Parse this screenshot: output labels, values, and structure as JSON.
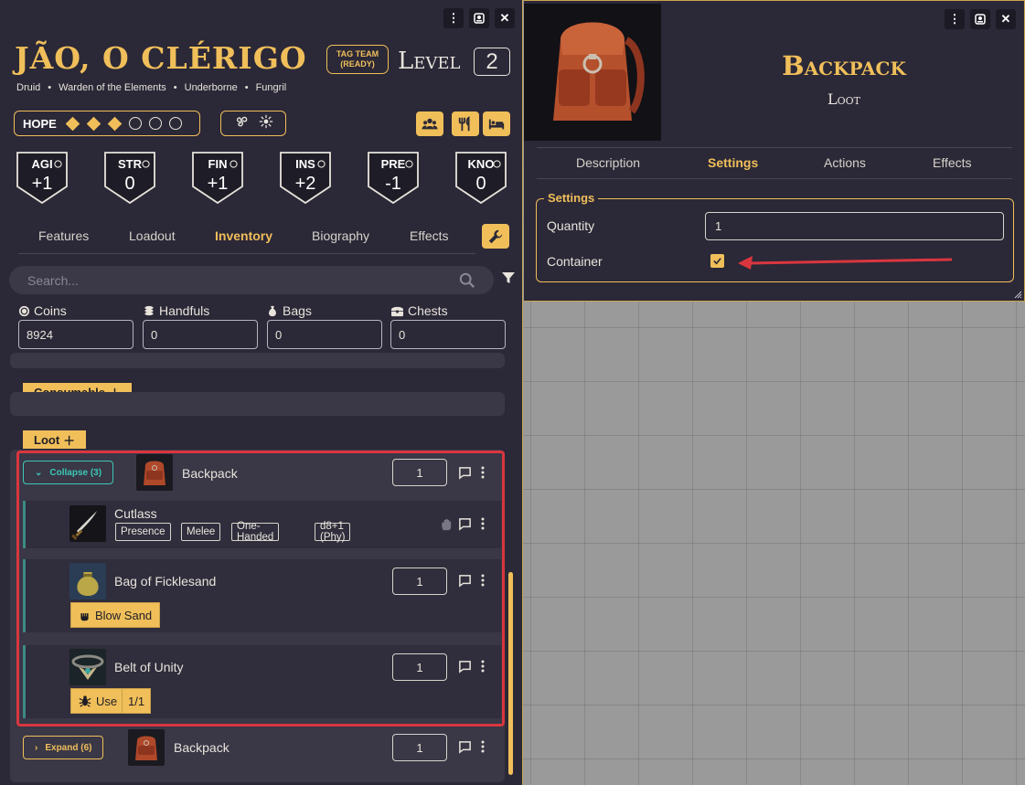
{
  "sheet": {
    "name": "JÃO, O CLÉRIGO",
    "subtitle": [
      "Druid",
      "Warden of the Elements",
      "Underborne",
      "Fungril"
    ],
    "subtitle_sep": "•",
    "tag_team": [
      "TAG TEAM",
      "(READY)"
    ],
    "level_label": "Level",
    "level": "2",
    "hope": {
      "label": "HOPE",
      "filled": 3,
      "total": 6
    },
    "traits": [
      {
        "name": "AGI",
        "value": "+1"
      },
      {
        "name": "STR",
        "value": "0"
      },
      {
        "name": "FIN",
        "value": "+1"
      },
      {
        "name": "INS",
        "value": "+2"
      },
      {
        "name": "PRE",
        "value": "-1"
      },
      {
        "name": "KNO",
        "value": "0"
      }
    ],
    "tabs": [
      "Features",
      "Loadout",
      "Inventory",
      "Biography",
      "Effects"
    ],
    "active_tab": "Inventory",
    "search_placeholder": "Search...",
    "currency": [
      {
        "label": "Coins",
        "value": "8924"
      },
      {
        "label": "Handfuls",
        "value": "0"
      },
      {
        "label": "Bags",
        "value": "0"
      },
      {
        "label": "Chests",
        "value": "0"
      }
    ],
    "categories": {
      "consumable": "Consumable",
      "loot": "Loot"
    },
    "loot": {
      "container": {
        "toggle": "Collapse (3)",
        "name": "Backpack",
        "qty": "1"
      },
      "children": [
        {
          "name": "Cutlass",
          "tags": [
            "Presence",
            "Melee",
            "One-Handed",
            "d8+1 (Phy)"
          ]
        },
        {
          "name": "Bag of Ficklesand",
          "qty": "1",
          "action": "Blow Sand"
        },
        {
          "name": "Belt of Unity",
          "qty": "1",
          "action": "Use",
          "uses": "1/1"
        }
      ],
      "container2": {
        "toggle": "Expand (6)",
        "name": "Backpack",
        "qty": "1"
      }
    }
  },
  "item": {
    "title": "Backpack",
    "subtitle": "Loot",
    "tabs": [
      "Description",
      "Settings",
      "Actions",
      "Effects"
    ],
    "active_tab": "Settings",
    "settings": {
      "legend": "Settings",
      "quantity_label": "Quantity",
      "quantity": "1",
      "container_label": "Container",
      "container_checked": true
    }
  },
  "colors": {
    "accent": "#f0bf5a",
    "panel": "#2b2837",
    "highlight": "#d9363e",
    "teal": "#3cc7b5"
  }
}
